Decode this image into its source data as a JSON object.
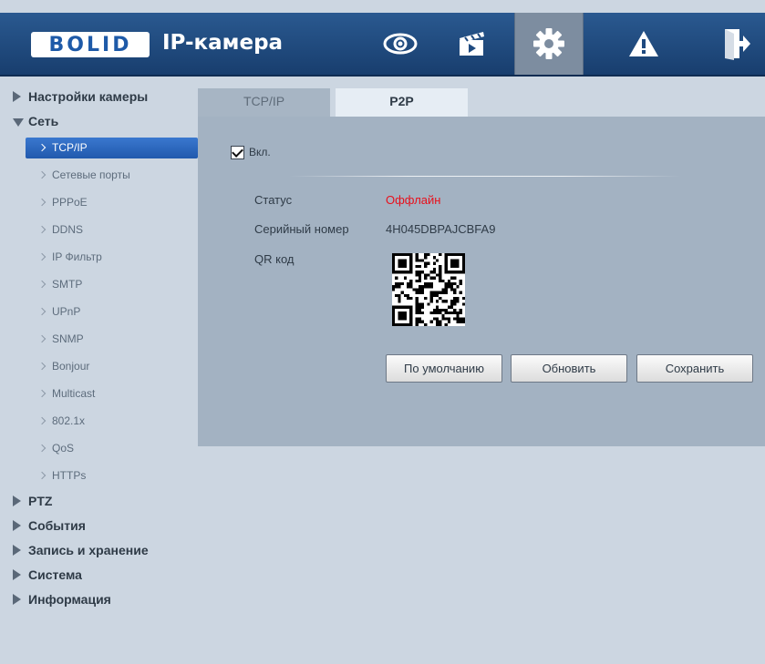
{
  "header": {
    "logo_text": "BOLID",
    "brand": "IP-камера",
    "nav": [
      {
        "icon": "eye-icon",
        "active": false
      },
      {
        "icon": "clapperboard-icon",
        "active": false
      },
      {
        "icon": "gear-icon",
        "active": true
      },
      {
        "icon": "warning-icon",
        "active": false
      },
      {
        "icon": "logout-icon",
        "active": false
      }
    ]
  },
  "sidebar": {
    "sections": [
      {
        "label": "Настройки камеры",
        "expanded": false
      },
      {
        "label": "Сеть",
        "expanded": true
      },
      {
        "label": "PTZ",
        "expanded": false
      },
      {
        "label": "События",
        "expanded": false
      },
      {
        "label": "Запись и хранение",
        "expanded": false
      },
      {
        "label": "Система",
        "expanded": false
      },
      {
        "label": "Информация",
        "expanded": false
      }
    ],
    "network_items": [
      {
        "label": "TCP/IP",
        "active": true
      },
      {
        "label": "Сетевые порты"
      },
      {
        "label": "PPPoE"
      },
      {
        "label": "DDNS"
      },
      {
        "label": "IP Фильтр"
      },
      {
        "label": "SMTP"
      },
      {
        "label": "UPnP"
      },
      {
        "label": "SNMP"
      },
      {
        "label": "Bonjour"
      },
      {
        "label": "Multicast"
      },
      {
        "label": "802.1x"
      },
      {
        "label": "QoS"
      },
      {
        "label": "HTTPs"
      }
    ]
  },
  "tabs": [
    {
      "label": "TCP/IP",
      "active": false
    },
    {
      "label": "P2P",
      "active": true
    }
  ],
  "p2p": {
    "enable_label": "Вкл.",
    "enabled": true,
    "status_label": "Статус",
    "status_value": "Оффлайн",
    "status_color": "#e8101c",
    "serial_label": "Серийный номер",
    "serial_value": "4H045DBPAJCBFA9",
    "qr_label": "QR код"
  },
  "buttons": {
    "default": "По умолчанию",
    "refresh": "Обновить",
    "save": "Сохранить"
  },
  "colors": {
    "header": "#1f4a80",
    "active_item": "#2c68c0",
    "panel": "#a3b2c2",
    "background": "#ccd6e1"
  }
}
